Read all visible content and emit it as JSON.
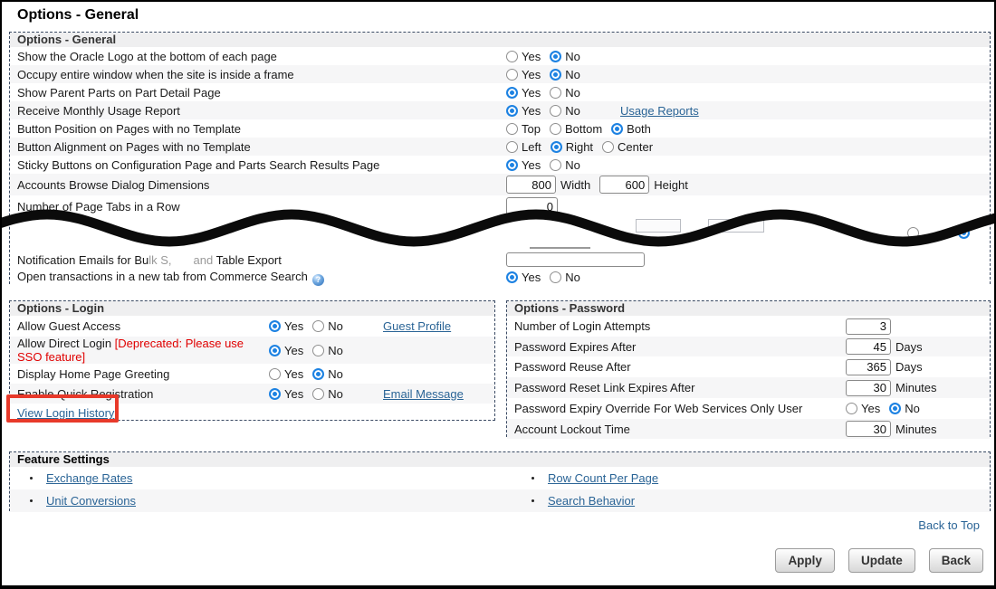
{
  "window": {
    "title": "Options - General"
  },
  "colors": {
    "link": "#2a6496",
    "radio_selected": "#1d82e2",
    "deprecated_red": "#e00000",
    "annotation_red": "#e8392a"
  },
  "sections": {
    "general": {
      "header": "Options - General",
      "rows": [
        {
          "label": "Show the Oracle Logo at the bottom of each page",
          "opts": [
            "Yes",
            "No"
          ],
          "selected": 1
        },
        {
          "label": "Occupy entire window when the site is inside a frame",
          "opts": [
            "Yes",
            "No"
          ],
          "selected": 1
        },
        {
          "label": "Show Parent Parts on Part Detail Page",
          "opts": [
            "Yes",
            "No"
          ],
          "selected": 0
        },
        {
          "label": "Receive Monthly Usage Report",
          "opts": [
            "Yes",
            "No"
          ],
          "selected": 0,
          "link": "Usage Reports"
        },
        {
          "label": "Button Position on Pages with no Template",
          "opts": [
            "Top",
            "Bottom",
            "Both"
          ],
          "selected": 2
        },
        {
          "label": "Button Alignment on Pages with no Template",
          "opts": [
            "Left",
            "Right",
            "Center"
          ],
          "selected": 1
        },
        {
          "label": "Sticky Buttons on Configuration Page and Parts Search Results Page",
          "opts": [
            "Yes",
            "No"
          ],
          "selected": 0
        },
        {
          "label": "Accounts Browse Dialog Dimensions",
          "inputs": [
            {
              "value": "800",
              "unit": "Width"
            },
            {
              "value": "600",
              "unit": "Height"
            }
          ]
        },
        {
          "label": "Number of Page Tabs in a Row",
          "inputs": [
            {
              "value": "0",
              "unit": ""
            }
          ]
        }
      ],
      "torn": {
        "notification": {
          "label_start": "Notification Emails for Bu",
          "label_faded1": "lk S,",
          "label_faded2": "and",
          "label_end": " Table Export",
          "input_value": ""
        },
        "open_transactions": {
          "label": "Open transactions in a new tab from Commerce Search",
          "help_glyph": "?",
          "opts": [
            "Yes",
            "No"
          ],
          "selected": 0
        }
      }
    },
    "login": {
      "header": "Options - Login",
      "rows": [
        {
          "label": "Allow Guest Access",
          "opts": [
            "Yes",
            "No"
          ],
          "selected": 0,
          "link": "Guest Profile"
        },
        {
          "label": "Allow Direct Login",
          "deprecated": "[Deprecated: Please use SSO feature]",
          "opts": [
            "Yes",
            "No"
          ],
          "selected": 0
        },
        {
          "label": "Display Home Page Greeting",
          "opts": [
            "Yes",
            "No"
          ],
          "selected": 1
        },
        {
          "label": "Enable Quick Registration",
          "opts": [
            "Yes",
            "No"
          ],
          "selected": 0,
          "link": "Email Message"
        }
      ],
      "history_link": "View Login History"
    },
    "password": {
      "header": "Options - Password",
      "rows": [
        {
          "label": "Number of Login Attempts",
          "value": "3",
          "unit": ""
        },
        {
          "label": "Password Expires After",
          "value": "45",
          "unit": "Days"
        },
        {
          "label": "Password Reuse After",
          "value": "365",
          "unit": "Days"
        },
        {
          "label": "Password Reset Link Expires After",
          "value": "30",
          "unit": "Minutes"
        },
        {
          "label": "Password Expiry Override For Web Services Only User",
          "opts": [
            "Yes",
            "No"
          ],
          "selected": 1
        },
        {
          "label": "Account Lockout Time",
          "value": "30",
          "unit": "Minutes"
        }
      ]
    },
    "features": {
      "header": "Feature Settings",
      "left_links": [
        "Exchange Rates",
        "Unit Conversions"
      ],
      "right_links": [
        "Row Count Per Page",
        "Search Behavior"
      ]
    }
  },
  "footer": {
    "back_to_top": "Back to Top",
    "buttons": [
      "Apply",
      "Update",
      "Back"
    ]
  }
}
